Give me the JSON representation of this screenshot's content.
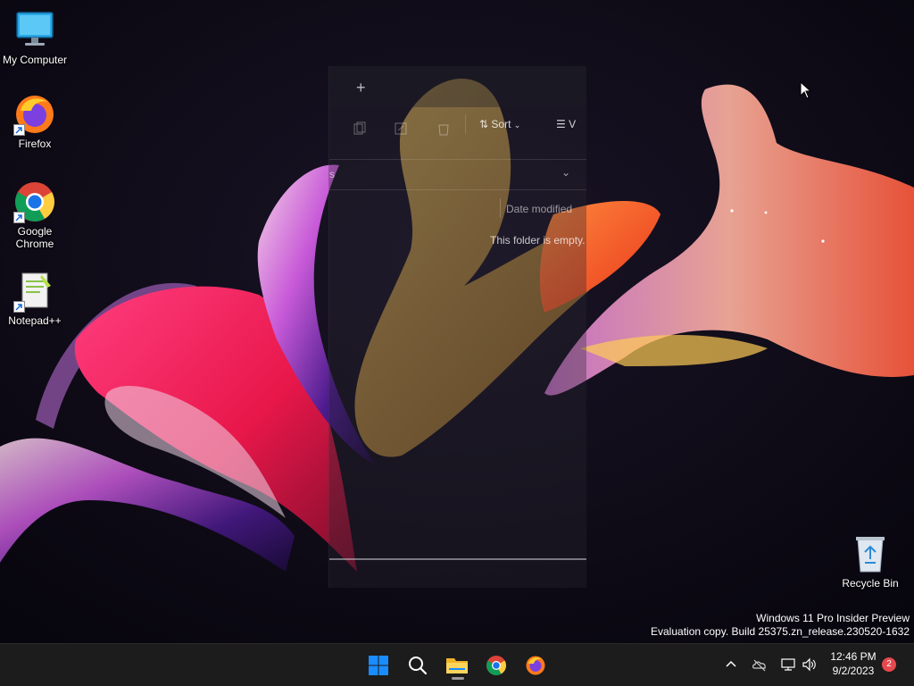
{
  "desktop": {
    "icons": [
      {
        "label": "My Computer",
        "icon": "monitor-icon"
      },
      {
        "label": "Firefox",
        "icon": "firefox-icon"
      },
      {
        "label": "Google Chrome",
        "icon": "chrome-icon"
      },
      {
        "label": "Notepad++",
        "icon": "notepadpp-icon"
      },
      {
        "label": "Recycle Bin",
        "icon": "recycle-bin-icon"
      }
    ]
  },
  "explorer_ghost": {
    "new_tab_label": "+",
    "sort_label": "Sort",
    "view_label": "V",
    "address_fragment": "s",
    "column_date_modified": "Date modified",
    "empty_message": "This folder is empty."
  },
  "watermark": {
    "line1": "Windows 11 Pro Insider Preview",
    "line2": "Evaluation copy. Build 25375.zn_release.230520-1632"
  },
  "taskbar": {
    "apps": [
      "start-icon",
      "search-icon",
      "file-explorer-icon",
      "chrome-icon",
      "firefox-icon"
    ],
    "clock_time": "12:46 PM",
    "clock_date": "9/2/2023",
    "notification_count": "2"
  },
  "colors": {
    "taskbar_bg": "#1c1c1c",
    "accent_blue": "#1a8cff",
    "badge_red": "#e5484d"
  }
}
